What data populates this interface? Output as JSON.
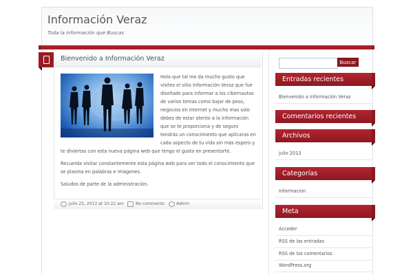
{
  "site": {
    "title": "Información Veraz",
    "description": "Toda la información que Buscas"
  },
  "post": {
    "title": "Bienvenido a Información Veraz",
    "paragraph1": [
      "Hola que tal me da mucho gusto que",
      "visites el sitio Información Veraz que fue",
      "diseñado para informar a los cibernautas",
      "de varios temas como bajar de peso,",
      "negocios en internet y mucho mas solo",
      "debes de estar atento a la información",
      "que se te proporciona y de seguro",
      "tendrás un conocimiento que aplicaras en",
      "cada aspecto de tu vida sin más espero y"
    ],
    "paragraph1_last": "te diviertas con esta nueva página web que tengo el gusto en presentarte.",
    "paragraph2_l1": "Recuerda visitar constantemente esta página web para ver todo el conocimiento que",
    "paragraph2_l2": "se plasma en palabras e imágenes.",
    "paragraph3": "Saludos de parte de la administración.",
    "date": "julio 25, 2013 at 10:22 am",
    "comments": "No comments",
    "author": "Admin",
    "image_icon": "business-people-globe-image"
  },
  "sidebar": {
    "search_button": "Buscar",
    "search_value": "",
    "widgets": {
      "recent_posts": {
        "title": "Entradas recientes",
        "items": [
          "Bienvenido a Información Veraz"
        ]
      },
      "recent_comments": {
        "title": "Comentarios recientes",
        "items": []
      },
      "archives": {
        "title": "Archivos",
        "items": [
          "julio 2013"
        ]
      },
      "categories": {
        "title": "Categorías",
        "items": [
          "Informacion"
        ]
      },
      "meta": {
        "title": "Meta",
        "items": [
          "Acceder",
          "RSS de las entradas",
          "RSS de los comentarios",
          "WordPress.org"
        ]
      }
    }
  },
  "colors": {
    "accent": "#981c25",
    "header_bg": "#f6f8fa"
  }
}
